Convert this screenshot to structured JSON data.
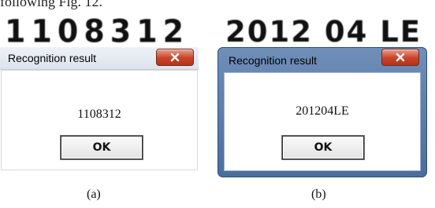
{
  "top_caption": "following Fig. 12.",
  "panels": [
    {
      "plate_text": "1108312",
      "dialog_title": "Recognition result",
      "result": "1108312",
      "ok_label": "OK",
      "caption": "(a)"
    },
    {
      "plate_text": "2012 04 LE",
      "dialog_title": "Recognition result",
      "result": "201204LE",
      "ok_label": "OK",
      "caption": "(b)"
    }
  ],
  "colors": {
    "close_button": "#c9422a",
    "window_frame_b": "#5a7aa8"
  },
  "icons": {
    "close": "close-icon"
  }
}
